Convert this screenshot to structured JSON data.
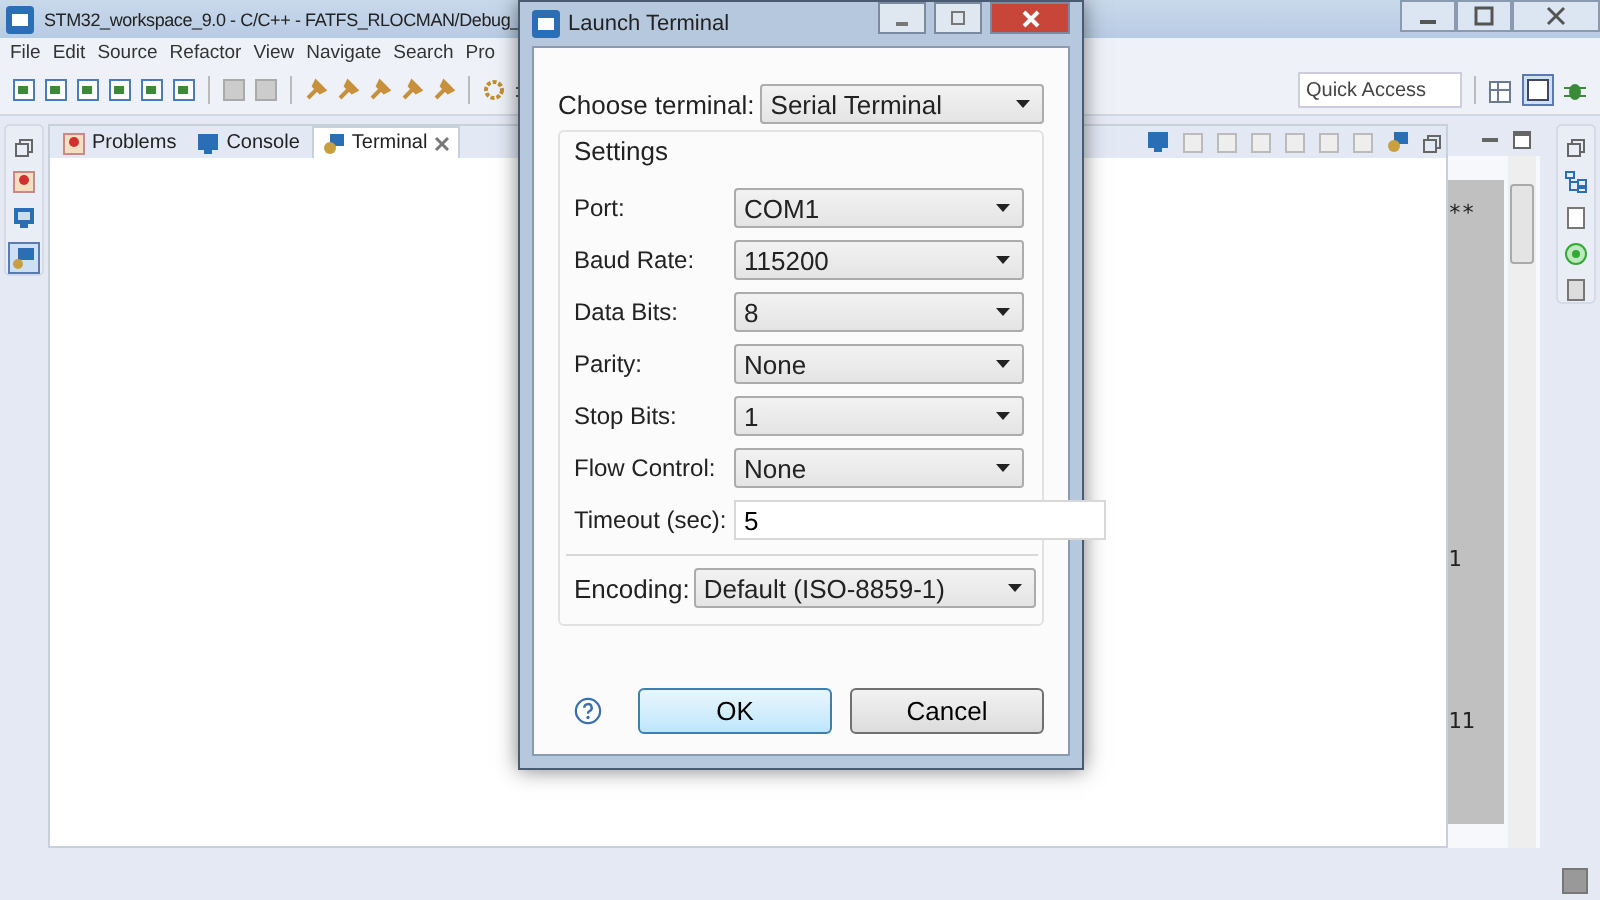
{
  "window": {
    "title": "STM32_workspace_9.0 - C/C++ - FATFS_RLOCMAN/Debug_"
  },
  "menu": [
    "File",
    "Edit",
    "Source",
    "Refactor",
    "View",
    "Navigate",
    "Search",
    "Pro"
  ],
  "toolbar": {
    "quick_access": {
      "placeholder": "Quick Access"
    }
  },
  "view_tabs": [
    {
      "label": "Problems",
      "selected": false
    },
    {
      "label": "Console",
      "selected": false
    },
    {
      "label": "Terminal",
      "selected": true
    }
  ],
  "side_panel": {
    "lines": [
      "**",
      "1",
      "11"
    ]
  },
  "dialog": {
    "title": "Launch Terminal",
    "terminal_label": "Choose terminal:",
    "terminal_value": "Serial Terminal",
    "group_title": "Settings",
    "fields": [
      {
        "kind": "select",
        "label": "Port:",
        "value": "COM1"
      },
      {
        "kind": "select",
        "label": "Baud Rate:",
        "value": "115200"
      },
      {
        "kind": "select",
        "label": "Data Bits:",
        "value": "8"
      },
      {
        "kind": "select",
        "label": "Parity:",
        "value": "None"
      },
      {
        "kind": "select",
        "label": "Stop Bits:",
        "value": "1"
      },
      {
        "kind": "select",
        "label": "Flow Control:",
        "value": "None"
      },
      {
        "kind": "text",
        "label": "Timeout (sec):",
        "value": "5"
      }
    ],
    "encoding": {
      "label": "Encoding:",
      "value": "Default (ISO-8859-1)"
    },
    "buttons": [
      {
        "label": "OK",
        "selected": true
      },
      {
        "label": "Cancel",
        "selected": false
      }
    ]
  }
}
